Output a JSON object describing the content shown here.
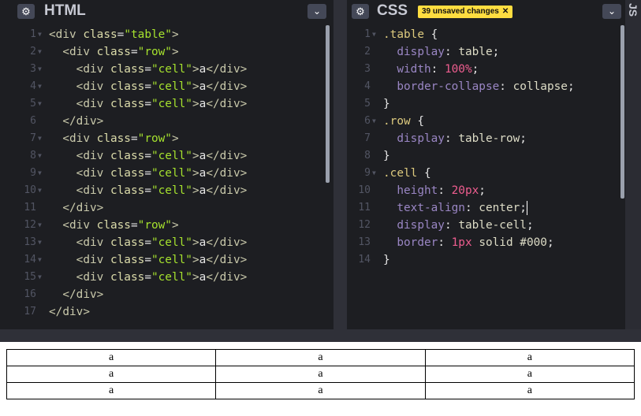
{
  "html_panel": {
    "title": "HTML",
    "gear_icon": "gear-icon",
    "collapse_icon": "chevron-down-icon",
    "lines": [
      {
        "n": "1",
        "fold": true,
        "tokens": [
          [
            "tag",
            "<div "
          ],
          [
            "attr",
            "class"
          ],
          [
            "plain",
            "="
          ],
          [
            "str",
            "\"table\""
          ],
          [
            "tag",
            ">"
          ]
        ]
      },
      {
        "n": "2",
        "fold": true,
        "tokens": [
          [
            "plain",
            "  "
          ],
          [
            "tag",
            "<div "
          ],
          [
            "attr",
            "class"
          ],
          [
            "plain",
            "="
          ],
          [
            "str",
            "\"row\""
          ],
          [
            "tag",
            ">"
          ]
        ]
      },
      {
        "n": "3",
        "fold": true,
        "tokens": [
          [
            "plain",
            "    "
          ],
          [
            "tag",
            "<div "
          ],
          [
            "attr",
            "class"
          ],
          [
            "plain",
            "="
          ],
          [
            "str",
            "\"cell\""
          ],
          [
            "tag",
            ">"
          ],
          [
            "plain",
            "a"
          ],
          [
            "tag",
            "</div>"
          ]
        ]
      },
      {
        "n": "4",
        "fold": true,
        "tokens": [
          [
            "plain",
            "    "
          ],
          [
            "tag",
            "<div "
          ],
          [
            "attr",
            "class"
          ],
          [
            "plain",
            "="
          ],
          [
            "str",
            "\"cell\""
          ],
          [
            "tag",
            ">"
          ],
          [
            "plain",
            "a"
          ],
          [
            "tag",
            "</div>"
          ]
        ]
      },
      {
        "n": "5",
        "fold": true,
        "tokens": [
          [
            "plain",
            "    "
          ],
          [
            "tag",
            "<div "
          ],
          [
            "attr",
            "class"
          ],
          [
            "plain",
            "="
          ],
          [
            "str",
            "\"cell\""
          ],
          [
            "tag",
            ">"
          ],
          [
            "plain",
            "a"
          ],
          [
            "tag",
            "</div>"
          ]
        ]
      },
      {
        "n": "6",
        "fold": false,
        "tokens": [
          [
            "plain",
            "  "
          ],
          [
            "tag",
            "</div>"
          ]
        ]
      },
      {
        "n": "7",
        "fold": true,
        "tokens": [
          [
            "plain",
            "  "
          ],
          [
            "tag",
            "<div "
          ],
          [
            "attr",
            "class"
          ],
          [
            "plain",
            "="
          ],
          [
            "str",
            "\"row\""
          ],
          [
            "tag",
            ">"
          ]
        ]
      },
      {
        "n": "8",
        "fold": true,
        "tokens": [
          [
            "plain",
            "    "
          ],
          [
            "tag",
            "<div "
          ],
          [
            "attr",
            "class"
          ],
          [
            "plain",
            "="
          ],
          [
            "str",
            "\"cell\""
          ],
          [
            "tag",
            ">"
          ],
          [
            "plain",
            "a"
          ],
          [
            "tag",
            "</div>"
          ]
        ]
      },
      {
        "n": "9",
        "fold": true,
        "tokens": [
          [
            "plain",
            "    "
          ],
          [
            "tag",
            "<div "
          ],
          [
            "attr",
            "class"
          ],
          [
            "plain",
            "="
          ],
          [
            "str",
            "\"cell\""
          ],
          [
            "tag",
            ">"
          ],
          [
            "plain",
            "a"
          ],
          [
            "tag",
            "</div>"
          ]
        ]
      },
      {
        "n": "10",
        "fold": true,
        "tokens": [
          [
            "plain",
            "    "
          ],
          [
            "tag",
            "<div "
          ],
          [
            "attr",
            "class"
          ],
          [
            "plain",
            "="
          ],
          [
            "str",
            "\"cell\""
          ],
          [
            "tag",
            ">"
          ],
          [
            "plain",
            "a"
          ],
          [
            "tag",
            "</div>"
          ]
        ]
      },
      {
        "n": "11",
        "fold": false,
        "tokens": [
          [
            "plain",
            "  "
          ],
          [
            "tag",
            "</div>"
          ]
        ]
      },
      {
        "n": "12",
        "fold": true,
        "tokens": [
          [
            "plain",
            "  "
          ],
          [
            "tag",
            "<div "
          ],
          [
            "attr",
            "class"
          ],
          [
            "plain",
            "="
          ],
          [
            "str",
            "\"row\""
          ],
          [
            "tag",
            ">"
          ]
        ]
      },
      {
        "n": "13",
        "fold": true,
        "tokens": [
          [
            "plain",
            "    "
          ],
          [
            "tag",
            "<div "
          ],
          [
            "attr",
            "class"
          ],
          [
            "plain",
            "="
          ],
          [
            "str",
            "\"cell\""
          ],
          [
            "tag",
            ">"
          ],
          [
            "plain",
            "a"
          ],
          [
            "tag",
            "</div>"
          ]
        ]
      },
      {
        "n": "14",
        "fold": true,
        "tokens": [
          [
            "plain",
            "    "
          ],
          [
            "tag",
            "<div "
          ],
          [
            "attr",
            "class"
          ],
          [
            "plain",
            "="
          ],
          [
            "str",
            "\"cell\""
          ],
          [
            "tag",
            ">"
          ],
          [
            "plain",
            "a"
          ],
          [
            "tag",
            "</div>"
          ]
        ]
      },
      {
        "n": "15",
        "fold": true,
        "tokens": [
          [
            "plain",
            "    "
          ],
          [
            "tag",
            "<div "
          ],
          [
            "attr",
            "class"
          ],
          [
            "plain",
            "="
          ],
          [
            "str",
            "\"cell\""
          ],
          [
            "tag",
            ">"
          ],
          [
            "plain",
            "a"
          ],
          [
            "tag",
            "</div>"
          ]
        ]
      },
      {
        "n": "16",
        "fold": false,
        "tokens": [
          [
            "plain",
            "  "
          ],
          [
            "tag",
            "</div>"
          ]
        ]
      },
      {
        "n": "17",
        "fold": false,
        "tokens": [
          [
            "tag",
            "</div>"
          ]
        ]
      }
    ]
  },
  "css_panel": {
    "title": "CSS",
    "badge": "39 unsaved changes",
    "badge_close_icon": "close-icon",
    "gear_icon": "gear-icon",
    "collapse_icon": "chevron-down-icon",
    "lines": [
      {
        "n": "1",
        "fold": true,
        "tokens": [
          [
            "sel",
            ".table"
          ],
          [
            "plain",
            " {"
          ]
        ]
      },
      {
        "n": "2",
        "fold": false,
        "tokens": [
          [
            "plain",
            "  "
          ],
          [
            "prop",
            "display"
          ],
          [
            "plain",
            ": "
          ],
          [
            "val",
            "table"
          ],
          [
            "plain",
            ";"
          ]
        ]
      },
      {
        "n": "3",
        "fold": false,
        "tokens": [
          [
            "plain",
            "  "
          ],
          [
            "prop",
            "width"
          ],
          [
            "plain",
            ": "
          ],
          [
            "num",
            "100%"
          ],
          [
            "plain",
            ";"
          ]
        ]
      },
      {
        "n": "4",
        "fold": false,
        "tokens": [
          [
            "plain",
            "  "
          ],
          [
            "prop",
            "border-collapse"
          ],
          [
            "plain",
            ": "
          ],
          [
            "val",
            "collapse"
          ],
          [
            "plain",
            ";"
          ]
        ]
      },
      {
        "n": "5",
        "fold": false,
        "tokens": [
          [
            "plain",
            "}"
          ]
        ]
      },
      {
        "n": "6",
        "fold": true,
        "tokens": [
          [
            "sel",
            ".row"
          ],
          [
            "plain",
            " {"
          ]
        ]
      },
      {
        "n": "7",
        "fold": false,
        "tokens": [
          [
            "plain",
            "  "
          ],
          [
            "prop",
            "display"
          ],
          [
            "plain",
            ": "
          ],
          [
            "val",
            "table-row"
          ],
          [
            "plain",
            ";"
          ]
        ]
      },
      {
        "n": "8",
        "fold": false,
        "tokens": [
          [
            "plain",
            "}"
          ]
        ]
      },
      {
        "n": "9",
        "fold": true,
        "tokens": [
          [
            "sel",
            ".cell"
          ],
          [
            "plain",
            " {"
          ]
        ]
      },
      {
        "n": "10",
        "fold": false,
        "tokens": [
          [
            "plain",
            "  "
          ],
          [
            "prop",
            "height"
          ],
          [
            "plain",
            ": "
          ],
          [
            "num",
            "20px"
          ],
          [
            "plain",
            ";"
          ]
        ]
      },
      {
        "n": "11",
        "fold": false,
        "tokens": [
          [
            "plain",
            "  "
          ],
          [
            "prop",
            "text-align"
          ],
          [
            "plain",
            ": "
          ],
          [
            "val",
            "center"
          ],
          [
            "plain",
            ";"
          ]
        ]
      },
      {
        "n": "12",
        "fold": false,
        "tokens": [
          [
            "plain",
            "  "
          ],
          [
            "prop",
            "display"
          ],
          [
            "plain",
            ": "
          ],
          [
            "val",
            "table-cell"
          ],
          [
            "plain",
            ";"
          ]
        ]
      },
      {
        "n": "13",
        "fold": false,
        "tokens": [
          [
            "plain",
            "  "
          ],
          [
            "prop",
            "border"
          ],
          [
            "plain",
            ": "
          ],
          [
            "num",
            "1px"
          ],
          [
            "plain",
            " "
          ],
          [
            "val",
            "solid #000"
          ],
          [
            "plain",
            ";"
          ]
        ]
      },
      {
        "n": "14",
        "fold": false,
        "tokens": [
          [
            "plain",
            "}"
          ]
        ]
      }
    ]
  },
  "js_panel": {
    "title": "JS"
  },
  "preview": {
    "rows": [
      [
        "a",
        "a",
        "a"
      ],
      [
        "a",
        "a",
        "a"
      ],
      [
        "a",
        "a",
        "a"
      ]
    ]
  },
  "colors": {
    "editor_bg": "#1d1e22",
    "badge_bg": "#ffdd40",
    "button_bg": "#444857"
  }
}
